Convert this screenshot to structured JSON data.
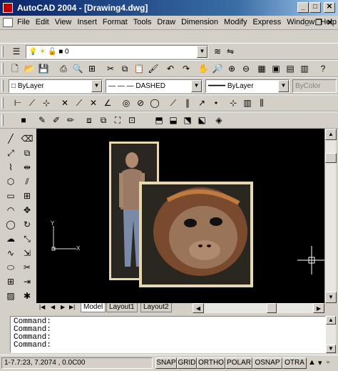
{
  "window": {
    "title": "AutoCAD 2004 - [Drawing4.dwg]",
    "minimize": "_",
    "maximize": "□",
    "close": "✕"
  },
  "menu": {
    "items": [
      "File",
      "Edit",
      "View",
      "Insert",
      "Format",
      "Tools",
      "Draw",
      "Dimension",
      "Modify",
      "Express",
      "Window",
      "Help"
    ],
    "doc_controls": [
      "_",
      "❐",
      "✕"
    ]
  },
  "layers_toolbar": {
    "layer_value": "0"
  },
  "properties_toolbar": {
    "color": "ByLayer",
    "linetype": "DASHED",
    "lineweight": "ByLayer",
    "plotstyle": "ByColor"
  },
  "layout_tabs": [
    "Model",
    "Layout1",
    "Layout2"
  ],
  "command_lines": [
    "Command:",
    "Command:",
    "Command:",
    "Command:"
  ],
  "status": {
    "coords": "1-7.7:23, 7.2074 , 0.0C00",
    "toggles": [
      "SNAP",
      "GRID",
      "ORTHO",
      "POLAR",
      "OSNAP",
      "OTRA"
    ]
  },
  "ucs": {
    "y_label": "Y",
    "x_label": "X"
  },
  "colors": {
    "canvas": "#000000",
    "titlebar": "#0a246a",
    "frame": "#e8d8b0"
  }
}
